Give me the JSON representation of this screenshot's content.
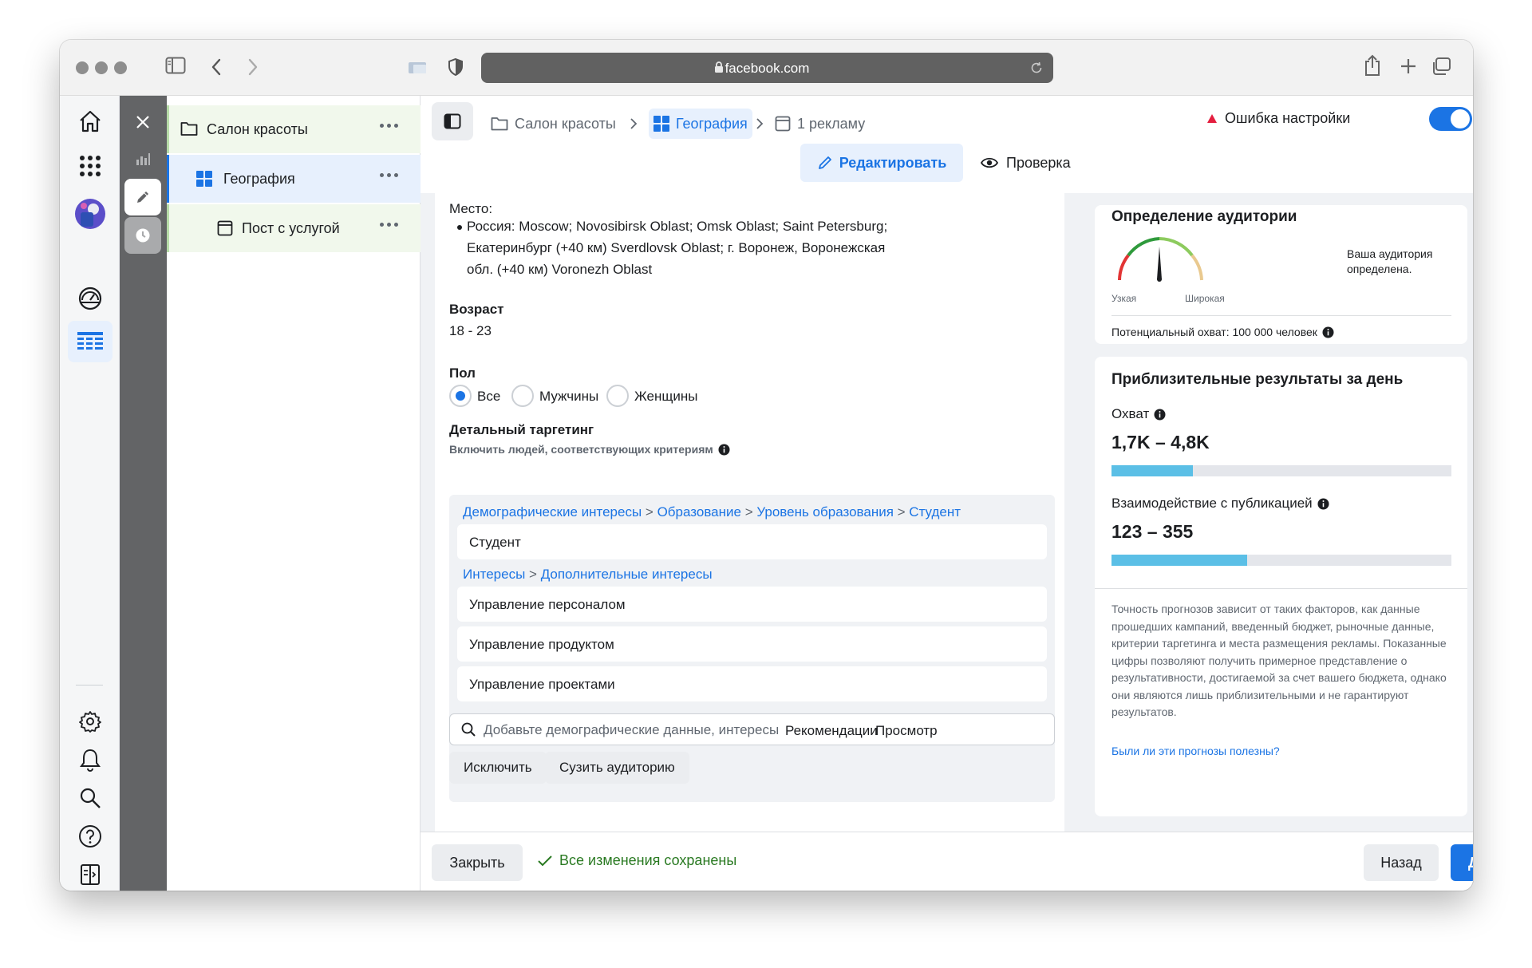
{
  "browser": {
    "url": "facebook.com"
  },
  "tree": {
    "items": [
      {
        "label": "Салон красоты"
      },
      {
        "label": "География"
      },
      {
        "label": "Пост с услугой"
      }
    ]
  },
  "breadcrumb": {
    "campaign": "Салон красоты",
    "adset": "География",
    "ad": "1 рекламу"
  },
  "status": {
    "error_label": "Ошибка настройки",
    "toggle_on": true
  },
  "modes": {
    "edit": "Редактировать",
    "preview": "Проверка"
  },
  "form": {
    "location_label": "Место:",
    "location_lines": [
      "Россия: Moscow; Novosibirsk Oblast; Omsk Oblast; Saint Petersburg;",
      "Екатеринбург (+40 км) Sverdlovsk Oblast; г. Воронеж, Воронежская",
      "обл. (+40 км) Voronezh Oblast"
    ],
    "age_label": "Возраст",
    "age_value": "18 - 23",
    "gender_label": "Пол",
    "gender_options": [
      "Все",
      "Мужчины",
      "Женщины"
    ],
    "gender_selected": "Все",
    "targeting_label": "Детальный таргетинг",
    "targeting_sublabel": "Включить людей, соответствующих критериям",
    "path1": [
      "Демографические интересы",
      "Образование",
      "Уровень образования",
      "Студент"
    ],
    "path1_items": [
      "Студент"
    ],
    "path2": [
      "Интересы",
      "Дополнительные интересы"
    ],
    "path2_items": [
      "Управление персоналом",
      "Управление продуктом",
      "Управление проектами"
    ],
    "search_placeholder": "Добавьте демографические данные, интересы или м",
    "search_recommendations": "Рекомендации",
    "search_browse": "Просмотр",
    "exclude_button": "Исключить",
    "narrow_button": "Сузить аудиторию"
  },
  "audience": {
    "title": "Определение аудитории",
    "narrow": "Узкая",
    "broad": "Широкая",
    "message": "Ваша аудитория определена.",
    "reach": "Потенциальный охват: 100 000 человек"
  },
  "estimates": {
    "title": "Приблизительные результаты за день",
    "reach_label": "Охват",
    "reach_value": "1,7K – 4,8K",
    "reach_fraction": 0.24,
    "engagement_label": "Взаимодействие с публикацией",
    "engagement_value": "123 – 355",
    "engagement_fraction": 0.4,
    "disclaimer": "Точность прогнозов зависит от таких факторов, как данные прошедших кампаний, введенный бюджет, рыночные данные, критерии таргетинга и места размещения рекламы. Показанные цифры позволяют получить примерное представление о результативности, достигаемой за счет вашего бюджета, однако они являются лишь приблизительными и не гарантируют результатов.",
    "feedback_link": "Были ли эти прогнозы полезны?"
  },
  "footer": {
    "close": "Закрыть",
    "saved": "Все изменения сохранены",
    "back": "Назад",
    "next": "Далее"
  },
  "colors": {
    "accent": "#1b74e4",
    "success": "#2a7a22",
    "error": "#e41e3f"
  }
}
